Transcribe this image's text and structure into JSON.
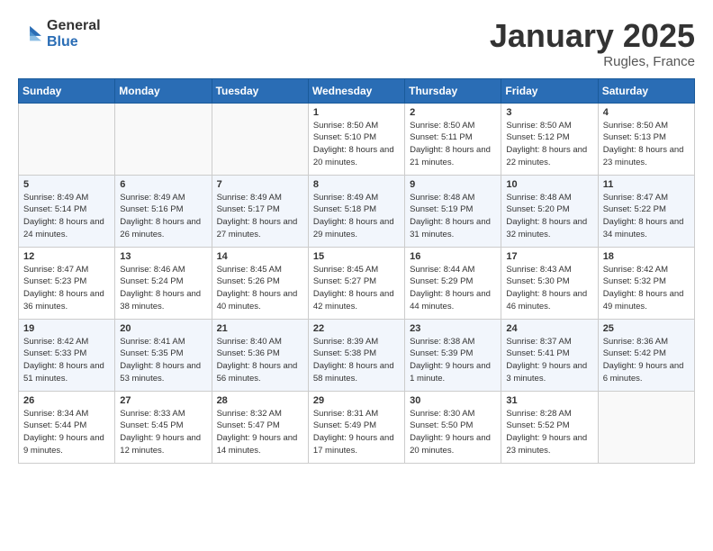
{
  "logo": {
    "general": "General",
    "blue": "Blue"
  },
  "header": {
    "month": "January 2025",
    "location": "Rugles, France"
  },
  "weekdays": [
    "Sunday",
    "Monday",
    "Tuesday",
    "Wednesday",
    "Thursday",
    "Friday",
    "Saturday"
  ],
  "weeks": [
    [
      {
        "day": "",
        "sunrise": "",
        "sunset": "",
        "daylight": ""
      },
      {
        "day": "",
        "sunrise": "",
        "sunset": "",
        "daylight": ""
      },
      {
        "day": "",
        "sunrise": "",
        "sunset": "",
        "daylight": ""
      },
      {
        "day": "1",
        "sunrise": "Sunrise: 8:50 AM",
        "sunset": "Sunset: 5:10 PM",
        "daylight": "Daylight: 8 hours and 20 minutes."
      },
      {
        "day": "2",
        "sunrise": "Sunrise: 8:50 AM",
        "sunset": "Sunset: 5:11 PM",
        "daylight": "Daylight: 8 hours and 21 minutes."
      },
      {
        "day": "3",
        "sunrise": "Sunrise: 8:50 AM",
        "sunset": "Sunset: 5:12 PM",
        "daylight": "Daylight: 8 hours and 22 minutes."
      },
      {
        "day": "4",
        "sunrise": "Sunrise: 8:50 AM",
        "sunset": "Sunset: 5:13 PM",
        "daylight": "Daylight: 8 hours and 23 minutes."
      }
    ],
    [
      {
        "day": "5",
        "sunrise": "Sunrise: 8:49 AM",
        "sunset": "Sunset: 5:14 PM",
        "daylight": "Daylight: 8 hours and 24 minutes."
      },
      {
        "day": "6",
        "sunrise": "Sunrise: 8:49 AM",
        "sunset": "Sunset: 5:16 PM",
        "daylight": "Daylight: 8 hours and 26 minutes."
      },
      {
        "day": "7",
        "sunrise": "Sunrise: 8:49 AM",
        "sunset": "Sunset: 5:17 PM",
        "daylight": "Daylight: 8 hours and 27 minutes."
      },
      {
        "day": "8",
        "sunrise": "Sunrise: 8:49 AM",
        "sunset": "Sunset: 5:18 PM",
        "daylight": "Daylight: 8 hours and 29 minutes."
      },
      {
        "day": "9",
        "sunrise": "Sunrise: 8:48 AM",
        "sunset": "Sunset: 5:19 PM",
        "daylight": "Daylight: 8 hours and 31 minutes."
      },
      {
        "day": "10",
        "sunrise": "Sunrise: 8:48 AM",
        "sunset": "Sunset: 5:20 PM",
        "daylight": "Daylight: 8 hours and 32 minutes."
      },
      {
        "day": "11",
        "sunrise": "Sunrise: 8:47 AM",
        "sunset": "Sunset: 5:22 PM",
        "daylight": "Daylight: 8 hours and 34 minutes."
      }
    ],
    [
      {
        "day": "12",
        "sunrise": "Sunrise: 8:47 AM",
        "sunset": "Sunset: 5:23 PM",
        "daylight": "Daylight: 8 hours and 36 minutes."
      },
      {
        "day": "13",
        "sunrise": "Sunrise: 8:46 AM",
        "sunset": "Sunset: 5:24 PM",
        "daylight": "Daylight: 8 hours and 38 minutes."
      },
      {
        "day": "14",
        "sunrise": "Sunrise: 8:45 AM",
        "sunset": "Sunset: 5:26 PM",
        "daylight": "Daylight: 8 hours and 40 minutes."
      },
      {
        "day": "15",
        "sunrise": "Sunrise: 8:45 AM",
        "sunset": "Sunset: 5:27 PM",
        "daylight": "Daylight: 8 hours and 42 minutes."
      },
      {
        "day": "16",
        "sunrise": "Sunrise: 8:44 AM",
        "sunset": "Sunset: 5:29 PM",
        "daylight": "Daylight: 8 hours and 44 minutes."
      },
      {
        "day": "17",
        "sunrise": "Sunrise: 8:43 AM",
        "sunset": "Sunset: 5:30 PM",
        "daylight": "Daylight: 8 hours and 46 minutes."
      },
      {
        "day": "18",
        "sunrise": "Sunrise: 8:42 AM",
        "sunset": "Sunset: 5:32 PM",
        "daylight": "Daylight: 8 hours and 49 minutes."
      }
    ],
    [
      {
        "day": "19",
        "sunrise": "Sunrise: 8:42 AM",
        "sunset": "Sunset: 5:33 PM",
        "daylight": "Daylight: 8 hours and 51 minutes."
      },
      {
        "day": "20",
        "sunrise": "Sunrise: 8:41 AM",
        "sunset": "Sunset: 5:35 PM",
        "daylight": "Daylight: 8 hours and 53 minutes."
      },
      {
        "day": "21",
        "sunrise": "Sunrise: 8:40 AM",
        "sunset": "Sunset: 5:36 PM",
        "daylight": "Daylight: 8 hours and 56 minutes."
      },
      {
        "day": "22",
        "sunrise": "Sunrise: 8:39 AM",
        "sunset": "Sunset: 5:38 PM",
        "daylight": "Daylight: 8 hours and 58 minutes."
      },
      {
        "day": "23",
        "sunrise": "Sunrise: 8:38 AM",
        "sunset": "Sunset: 5:39 PM",
        "daylight": "Daylight: 9 hours and 1 minute."
      },
      {
        "day": "24",
        "sunrise": "Sunrise: 8:37 AM",
        "sunset": "Sunset: 5:41 PM",
        "daylight": "Daylight: 9 hours and 3 minutes."
      },
      {
        "day": "25",
        "sunrise": "Sunrise: 8:36 AM",
        "sunset": "Sunset: 5:42 PM",
        "daylight": "Daylight: 9 hours and 6 minutes."
      }
    ],
    [
      {
        "day": "26",
        "sunrise": "Sunrise: 8:34 AM",
        "sunset": "Sunset: 5:44 PM",
        "daylight": "Daylight: 9 hours and 9 minutes."
      },
      {
        "day": "27",
        "sunrise": "Sunrise: 8:33 AM",
        "sunset": "Sunset: 5:45 PM",
        "daylight": "Daylight: 9 hours and 12 minutes."
      },
      {
        "day": "28",
        "sunrise": "Sunrise: 8:32 AM",
        "sunset": "Sunset: 5:47 PM",
        "daylight": "Daylight: 9 hours and 14 minutes."
      },
      {
        "day": "29",
        "sunrise": "Sunrise: 8:31 AM",
        "sunset": "Sunset: 5:49 PM",
        "daylight": "Daylight: 9 hours and 17 minutes."
      },
      {
        "day": "30",
        "sunrise": "Sunrise: 8:30 AM",
        "sunset": "Sunset: 5:50 PM",
        "daylight": "Daylight: 9 hours and 20 minutes."
      },
      {
        "day": "31",
        "sunrise": "Sunrise: 8:28 AM",
        "sunset": "Sunset: 5:52 PM",
        "daylight": "Daylight: 9 hours and 23 minutes."
      },
      {
        "day": "",
        "sunrise": "",
        "sunset": "",
        "daylight": ""
      }
    ]
  ]
}
